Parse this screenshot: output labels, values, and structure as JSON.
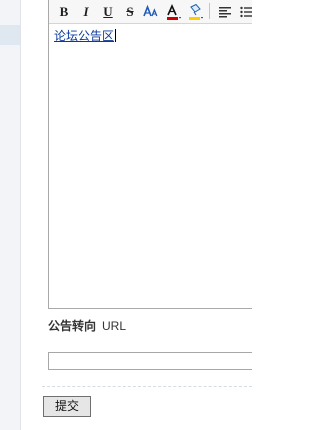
{
  "toolbar": {
    "bold_label": "B",
    "italic_label": "I",
    "underline_label": "U",
    "strike_label": "S",
    "icons": {
      "font_size": "font-size-icon",
      "font_color": "font-color-icon",
      "background_color": "background-color-icon",
      "align": "align-left-icon",
      "list": "unordered-list-icon"
    },
    "colors": {
      "font_color_red": "#d00000",
      "highlight_yellow": "#ffcc00"
    }
  },
  "editor": {
    "content": "论坛公告区"
  },
  "announcement_url": {
    "label_cn": "公告转向",
    "label_en": "URL",
    "value": ""
  },
  "actions": {
    "submit_label": "提交"
  }
}
